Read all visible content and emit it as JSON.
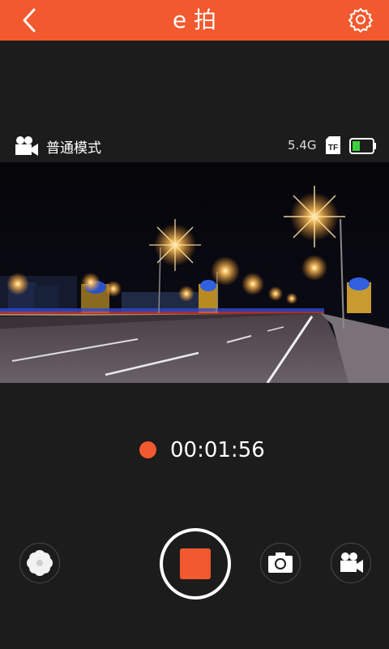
{
  "header": {
    "title": "e 拍",
    "back_icon": "chevron-left-icon",
    "settings_icon": "gear-icon"
  },
  "status": {
    "mode_label": "普通模式",
    "storage": "5.4G",
    "battery_level": 0.3
  },
  "recording": {
    "elapsed": "00:01:56"
  },
  "preview": {
    "description_icon": "live-camera-preview"
  },
  "controls": {
    "filter_icon": "flower-icon",
    "stop_icon": "stop-record-icon",
    "photo_icon": "camera-icon",
    "video_icon": "video-camera-icon"
  },
  "colors": {
    "accent": "#f2592e",
    "background": "#1c1c1c"
  }
}
